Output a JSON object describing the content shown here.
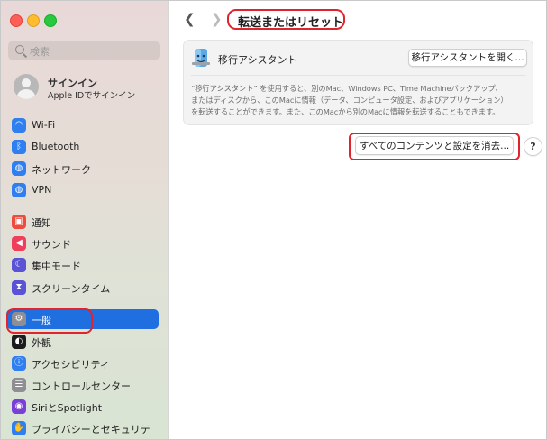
{
  "search": {
    "placeholder": "検索"
  },
  "account": {
    "name": "サインイン",
    "subtitle": "Apple IDでサインイン"
  },
  "sidebar": {
    "items": [
      {
        "label": "Wi-Fi",
        "icon": "wifi-icon",
        "color": "#2f7ff0",
        "glyph": "◠"
      },
      {
        "label": "Bluetooth",
        "icon": "bluetooth-icon",
        "color": "#2f7ff0",
        "glyph": "ᛒ"
      },
      {
        "label": "ネットワーク",
        "icon": "network-icon",
        "color": "#2f7ff0",
        "glyph": "◍"
      },
      {
        "label": "VPN",
        "icon": "vpn-icon",
        "color": "#2f7ff0",
        "glyph": "◍"
      },
      {
        "label": "通知",
        "icon": "notifications-icon",
        "color": "#ef4b3f",
        "glyph": "▣"
      },
      {
        "label": "サウンド",
        "icon": "sound-icon",
        "color": "#ef3f5b",
        "glyph": "◀"
      },
      {
        "label": "集中モード",
        "icon": "focus-icon",
        "color": "#5a53d6",
        "glyph": "☾"
      },
      {
        "label": "スクリーンタイム",
        "icon": "screen-time-icon",
        "color": "#5a53d6",
        "glyph": "⧗"
      },
      {
        "label": "一般",
        "icon": "general-gear-icon",
        "color": "#8e8e93",
        "glyph": "⚙",
        "selected": true
      },
      {
        "label": "外観",
        "icon": "appearance-icon",
        "color": "#1c1c1e",
        "glyph": "◐"
      },
      {
        "label": "アクセシビリティ",
        "icon": "accessibility-icon",
        "color": "#2f7ff0",
        "glyph": "ⓘ"
      },
      {
        "label": "コントロールセンター",
        "icon": "control-center-icon",
        "color": "#8e8e93",
        "glyph": "☰"
      },
      {
        "label": "SiriとSpotlight",
        "icon": "siri-icon",
        "color": "#7a3fd6",
        "glyph": "◉"
      },
      {
        "label": "プライバシーとセキュリティ",
        "icon": "privacy-hand-icon",
        "color": "#2f7ff0",
        "glyph": "✋"
      }
    ]
  },
  "main": {
    "title": "転送またはリセット",
    "migration": {
      "label": "移行アシスタント",
      "open_button": "移行アシスタントを開く...",
      "description_lines": [
        "“移行アシスタント” を使用すると、別のMac、Windows PC、Time Machineバックアップ、",
        "またはディスクから、このMacに情報（データ、コンピュータ設定、およびアプリケーション）",
        "を転送することができます。また、このMacから別のMacに情報を転送することもできます。"
      ]
    },
    "erase_button": "すべてのコンテンツと設定を消去...",
    "help_label": "?"
  },
  "colors": {
    "accent": "#1f6fe0",
    "annotation": "#e0242d"
  }
}
